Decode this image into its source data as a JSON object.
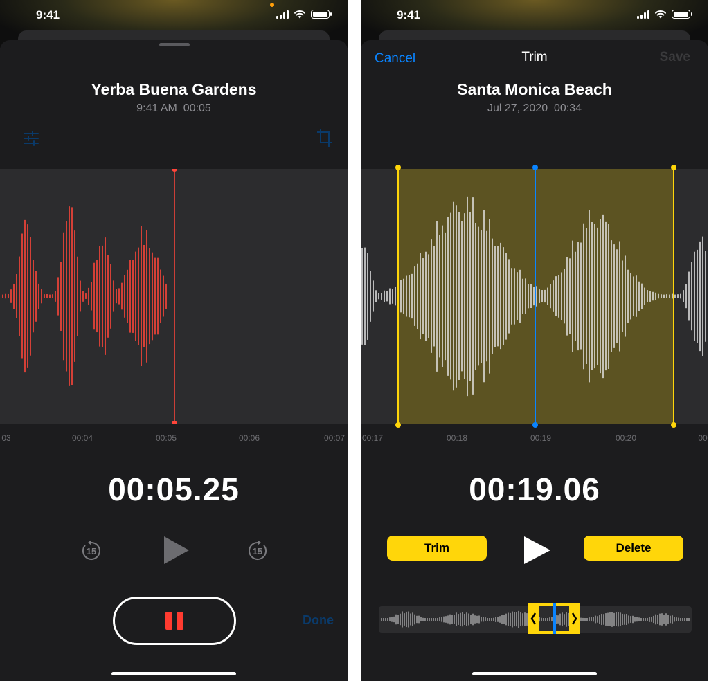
{
  "colors": {
    "recording_red": "#ff453a",
    "accent_blue": "#0a84ff",
    "trim_yellow": "#ffd60a",
    "waveform_white": "#e8e8e8"
  },
  "left_screen": {
    "status": {
      "time": "9:41"
    },
    "recording": {
      "title": "Yerba Buena Gardens",
      "meta_time": "9:41 AM",
      "meta_duration": "00:05"
    },
    "icons": {
      "options": "sliders-icon",
      "trim": "crop-icon"
    },
    "timeline": {
      "labels": [
        "03",
        "00:04",
        "00:05",
        "00:06",
        "00:07"
      ]
    },
    "playback": {
      "elapsed": "00:05.25",
      "skip_back": "15",
      "skip_forward": "15"
    },
    "done_label": "Done"
  },
  "right_screen": {
    "status": {
      "time": "9:41"
    },
    "nav": {
      "cancel": "Cancel",
      "title": "Trim",
      "save": "Save"
    },
    "recording": {
      "title": "Santa Monica Beach",
      "meta_date": "Jul 27, 2020",
      "meta_duration": "00:34"
    },
    "timeline": {
      "labels": [
        "00:17",
        "00:18",
        "00:19",
        "00:20",
        "00"
      ]
    },
    "playback": {
      "elapsed": "00:19.06"
    },
    "buttons": {
      "trim": "Trim",
      "delete": "Delete"
    }
  }
}
